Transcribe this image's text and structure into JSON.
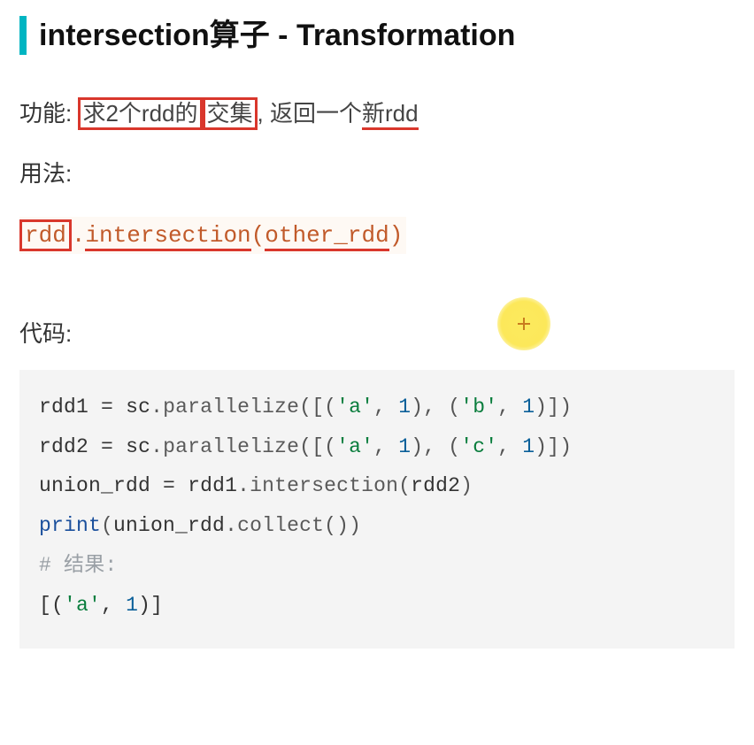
{
  "heading": {
    "part1": "intersection算子",
    "sep": " - ",
    "part2": "Transformation"
  },
  "func": {
    "label": "功能:",
    "boxed1": "求2个rdd的",
    "boxed2": "交集",
    "mid": ", 返回一个",
    "underlined": "新rdd"
  },
  "usage": {
    "label": "用法:",
    "code": {
      "rdd": "rdd",
      "dot": ".",
      "method": "intersection",
      "open": "(",
      "arg": "other_rdd",
      "close": ")"
    }
  },
  "code": {
    "label": "代码:",
    "lines": [
      "rdd1 = sc.parallelize([('a', 1), ('b', 1)])",
      "rdd2 = sc.parallelize([('a', 1), ('c', 1)])",
      "union_rdd = rdd1.intersection(rdd2)",
      "print(union_rdd.collect())",
      "# 结果:",
      "[('a', 1)]"
    ]
  }
}
